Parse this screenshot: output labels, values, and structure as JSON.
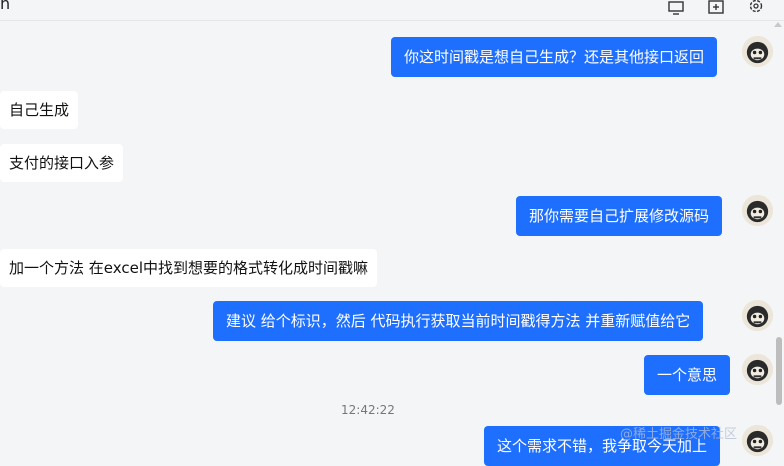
{
  "header": {
    "title_fragment": "n",
    "icons": [
      "monitor-icon",
      "add-window-icon",
      "settings-icon"
    ]
  },
  "messages": [
    {
      "side": "out",
      "text": "你这时间戳是想自己生成？还是其他接口返回"
    },
    {
      "side": "in",
      "text": "自己生成"
    },
    {
      "side": "in",
      "text": "支付的接口入参"
    },
    {
      "side": "out",
      "text": "那你需要自己扩展修改源码"
    },
    {
      "side": "in",
      "text": "加一个方法 在excel中找到想要的格式转化成时间戳嘛"
    },
    {
      "side": "out",
      "text": "建议 给个标识，然后 代码执行获取当前时间戳得方法 并重新赋值给它"
    },
    {
      "side": "out",
      "text": "一个意思"
    },
    {
      "side": "out",
      "text": "这个需求不错，我争取今天加上"
    }
  ],
  "timestamp": "12:42:22",
  "watermark": "@稀土掘金技术社区",
  "colors": {
    "outgoing_bubble": "#1f6fff",
    "incoming_bubble": "#ffffff",
    "background": "#f4f5f7"
  }
}
